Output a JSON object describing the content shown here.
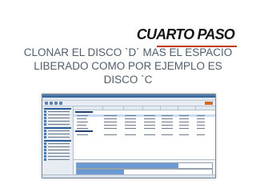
{
  "slide": {
    "title": "CUARTO PASO",
    "body": "CLONAR EL DISCO `D´ MAS EL ESPACIO LIBERADO COMO POR EJEMPLO ES DISCO `C",
    "accent_color": "#c13a12",
    "body_color": "#4e5e6e"
  },
  "screenshot": {
    "title_bar_color": "#2c5a90",
    "sidebar_icon": "disk-icon",
    "selection_color": "#c8ddf4"
  }
}
